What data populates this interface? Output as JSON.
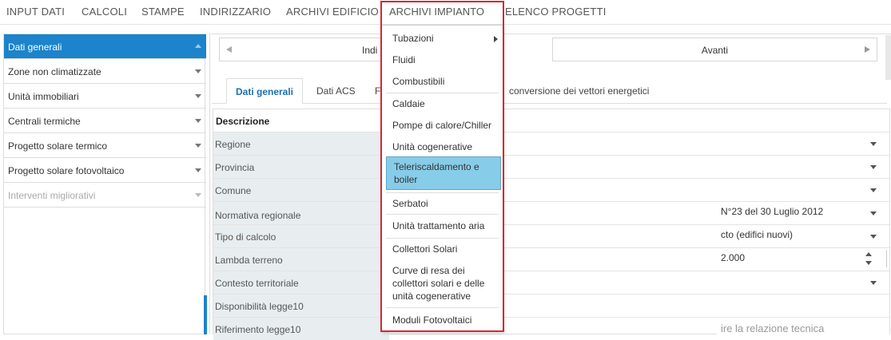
{
  "menubar": {
    "items": [
      "INPUT DATI",
      "CALCOLI",
      "STAMPE",
      "INDIRIZZARIO",
      "ARCHIVI EDIFICIO",
      "ARCHIVI IMPIANTO",
      "ELENCO PROGETTI"
    ]
  },
  "sidebar": {
    "items": [
      {
        "label": "Dati generali"
      },
      {
        "label": "Zone non climatizzate"
      },
      {
        "label": "Unità immobiliari"
      },
      {
        "label": "Centrali termiche"
      },
      {
        "label": "Progetto solare termico"
      },
      {
        "label": "Progetto solare fotovoltaico"
      },
      {
        "label": "Interventi migliorativi"
      }
    ]
  },
  "nav": {
    "back_label": "Indi",
    "next_label": "Avanti"
  },
  "tabs": [
    "Dati generali",
    "Dati ACS",
    "F",
    "conversione dei vettori energetici"
  ],
  "grid": {
    "header": "Descrizione",
    "rows": [
      {
        "label": "Regione",
        "value": ""
      },
      {
        "label": "Provincia",
        "value": ""
      },
      {
        "label": "Comune",
        "value": ""
      },
      {
        "label": "Normativa regionale",
        "value": "N°23 del 30 Luglio 2012"
      },
      {
        "label": "Tipo di calcolo",
        "value": "cto (edifici nuovi)"
      },
      {
        "label": "Lambda terreno",
        "value": "2.000"
      },
      {
        "label": "Contesto territoriale",
        "value": ""
      },
      {
        "label": "Disponibilità legge10",
        "value": ""
      },
      {
        "label": "Riferimento legge10",
        "value": "ire la relazione tecnica"
      }
    ]
  },
  "dropdown": {
    "items": [
      "Tubazioni",
      "Fluidi",
      "Combustibili",
      "Caldaie",
      "Pompe di calore/Chiller",
      "Unità cogenerative",
      "Teleriscaldamento e boiler",
      "Serbatoi",
      "Unità trattamento aria",
      "Collettori Solari",
      "Curve di resa dei collettori solari e delle unità cogenerative",
      "Moduli Fotovoltaici"
    ]
  },
  "colors": {
    "accent": "#1b84cc",
    "highlight_border": "#d9262e",
    "dropdown_active": "#87cce8"
  }
}
